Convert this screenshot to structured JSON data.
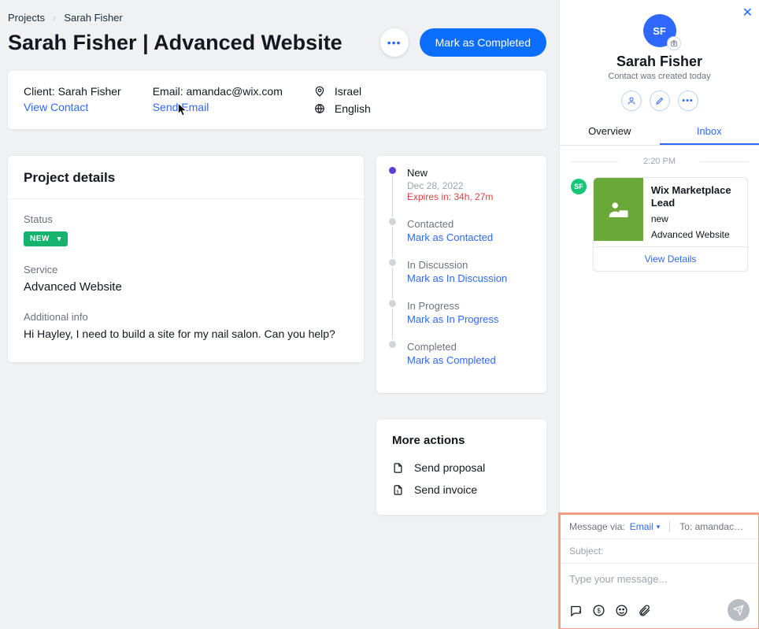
{
  "breadcrumb": {
    "root": "Projects",
    "current": "Sarah Fisher"
  },
  "page": {
    "title": "Sarah Fisher | Advanced Website",
    "complete_button": "Mark as Completed"
  },
  "client": {
    "client_label": "Client: Sarah Fisher",
    "view_contact": "View Contact",
    "email_label": "Email: amandac@wix.com",
    "send_email": "Send Email",
    "country": "Israel",
    "language": "English"
  },
  "details": {
    "heading": "Project details",
    "status_label": "Status",
    "status_badge": "NEW",
    "service_label": "Service",
    "service_value": "Advanced Website",
    "info_label": "Additional info",
    "info_value": "Hi Hayley, I need to build a site for my nail salon. Can you help?"
  },
  "timeline": [
    {
      "name": "New",
      "date": "Dec 28, 2022",
      "expires": "Expires in: 34h, 27m",
      "action": ""
    },
    {
      "name": "Contacted",
      "action": "Mark as Contacted"
    },
    {
      "name": "In Discussion",
      "action": "Mark as In Discussion"
    },
    {
      "name": "In Progress",
      "action": "Mark as In Progress"
    },
    {
      "name": "Completed",
      "action": "Mark as Completed"
    }
  ],
  "more_actions": {
    "heading": "More actions",
    "proposal": "Send proposal",
    "invoice": "Send invoice"
  },
  "sidepanel": {
    "initials": "SF",
    "name": "Sarah Fisher",
    "sub": "Contact was created today",
    "tab_overview": "Overview",
    "tab_inbox": "Inbox",
    "time": "2:20 PM",
    "lead_title": "Wix Marketplace Lead",
    "lead_sub1": "new",
    "lead_sub2": "Advanced Website",
    "view_details": "View Details"
  },
  "compose": {
    "via_label": "Message via:",
    "channel": "Email",
    "to": "To: amandac…",
    "subject_ph": "Subject:",
    "body_ph": "Type your message..."
  }
}
